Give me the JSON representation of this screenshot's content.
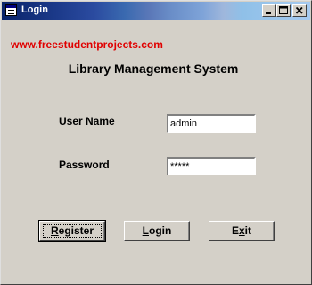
{
  "window": {
    "title": "Login",
    "controls": {
      "minimize": "minimize",
      "maximize": "maximize",
      "close": "close"
    }
  },
  "site_link": "www.freestudentprojects.com",
  "app_title": "Library Management System",
  "form": {
    "username_label": "User Name",
    "username_value": "admin",
    "password_label": "Password",
    "password_value": "*****"
  },
  "buttons": {
    "register": {
      "first": "R",
      "rest": "egister"
    },
    "login": {
      "first": "L",
      "rest": "ogin"
    },
    "exit": {
      "pre": "E",
      "underlined": "x",
      "post": "it"
    }
  },
  "colors": {
    "link": "#e00000",
    "titlebar_start": "#0a246a",
    "window_bg": "#d4d0c8"
  },
  "icons": {
    "title": "window-app-icon"
  }
}
